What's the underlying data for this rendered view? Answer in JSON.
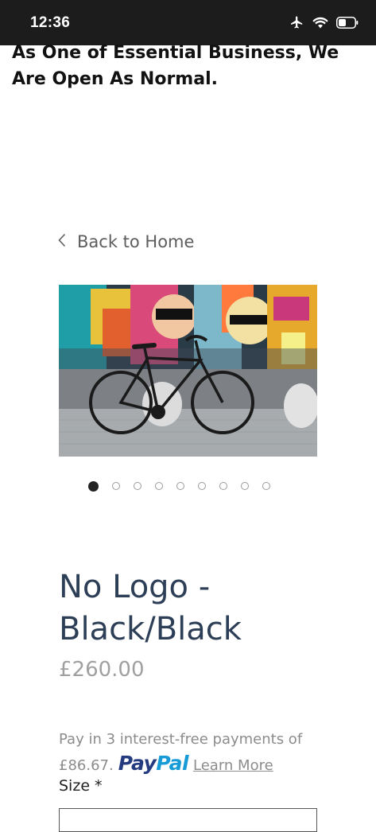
{
  "status_bar": {
    "time": "12:36",
    "icons": [
      "airplane-icon",
      "wifi-icon",
      "battery-icon"
    ]
  },
  "banner": {
    "line1": "As One of Essential Business, We",
    "line2": "Are Open As Normal."
  },
  "navigation": {
    "back_label": "Back to Home"
  },
  "product": {
    "title_line1": "No Logo -",
    "title_line2": "Black/Black",
    "price": "£260.00",
    "image_alt": "black fixie bicycle in front of graffiti wall",
    "gallery": {
      "count": 9,
      "active_index": 0
    }
  },
  "paypal": {
    "line1": "Pay in 3 interest-free payments of",
    "amount": "£86.67.",
    "logo_pay": "Pay",
    "logo_pal": "Pal",
    "learn_more": "Learn More"
  },
  "options": {
    "size_label": "Size *"
  },
  "colors": {
    "title": "#2d3f57",
    "price": "#a0a0a0",
    "paypal_blue_dark": "#253b80",
    "paypal_blue_light": "#179bd7",
    "status_bar_bg": "#1c1c1c"
  }
}
